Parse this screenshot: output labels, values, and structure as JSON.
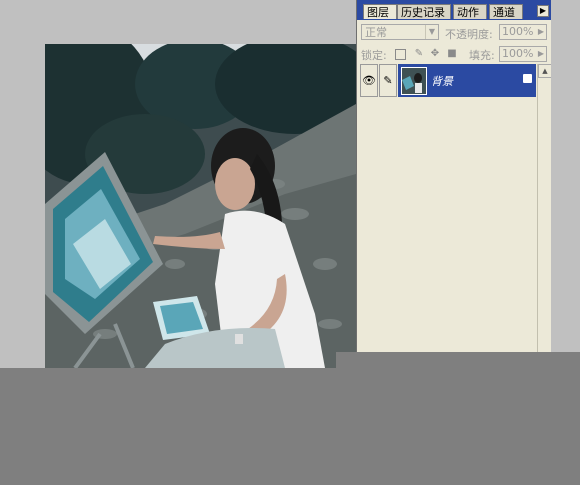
{
  "panel": {
    "tabs": [
      {
        "label": "图层",
        "active": true
      },
      {
        "label": "历史记录",
        "active": false
      },
      {
        "label": "动作",
        "active": false
      },
      {
        "label": "通道",
        "active": false
      }
    ],
    "menu_arrow": "▶",
    "blend_mode": "正常",
    "opacity_label": "不透明度:",
    "opacity_value": "100%",
    "lock_label": "锁定:",
    "fill_label": "填充:",
    "fill_value": "100%",
    "layer": {
      "name": "背景",
      "visible": true,
      "locked": true,
      "eye_icon": "eye-icon",
      "brush_icon": "brush-icon",
      "lock_icon": "lock-icon"
    }
  },
  "colors": {
    "panel_bg": "#ece9d8",
    "selection": "#2b4aa2",
    "workspace": "#c0c0c0",
    "bottom": "#7f7f7f"
  }
}
